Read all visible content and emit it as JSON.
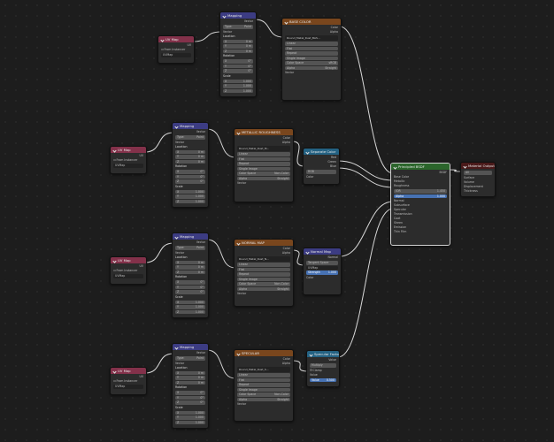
{
  "uv_node": {
    "title": "UV Map",
    "output": "UV",
    "from_instancer_label": "From Instancer",
    "map_value": "UVMap"
  },
  "mapping_node": {
    "title": "Mapping",
    "output": "Vector",
    "type_label": "Type:",
    "type_value": "Point",
    "vector_label": "Vector",
    "location_label": "Location",
    "rotation_label": "Rotation",
    "scale_label": "Scale",
    "x_label": "X",
    "y_label": "Y",
    "z_label": "Z",
    "loc_values": [
      "0 m",
      "0 m",
      "0 m"
    ],
    "rot_values": [
      "0°",
      "0°",
      "0°"
    ],
    "scale_values": [
      "1.000",
      "1.000",
      "1.000"
    ]
  },
  "tex_base": {
    "title": "BASE COLOR",
    "outputs": [
      "Color",
      "Alpha"
    ],
    "image": "Round_Metal_Rust_BAS...",
    "interp": "Linear",
    "proj": "Flat",
    "ext": "Repeat",
    "source": "Single Image",
    "colorspace_label": "Color Space",
    "colorspace": "sRGB",
    "alpha_label": "Alpha",
    "alpha": "Straight",
    "vector_label": "Vector"
  },
  "tex_metal": {
    "title": "METALLIC ROUGHNESS",
    "outputs": [
      "Color",
      "Alpha"
    ],
    "image": "Round_Metal_Rust_M...",
    "interp": "Linear",
    "proj": "Flat",
    "ext": "Repeat",
    "source": "Single Image",
    "colorspace_label": "Color Space",
    "colorspace": "Non-Color",
    "alpha_label": "Alpha",
    "alpha": "Straight",
    "vector_label": "Vector"
  },
  "tex_normal": {
    "title": "NORMAL MAP",
    "outputs": [
      "Color",
      "Alpha"
    ],
    "image": "Round_Metal_Rust_N...",
    "interp": "Linear",
    "proj": "Flat",
    "ext": "Repeat",
    "source": "Single Image",
    "colorspace_label": "Color Space",
    "colorspace": "Non-Color",
    "alpha_label": "Alpha",
    "alpha": "Straight",
    "vector_label": "Vector"
  },
  "tex_spec": {
    "title": "SPECULAR",
    "outputs": [
      "Color",
      "Alpha"
    ],
    "image": "Round_Metal_Rust_S...",
    "interp": "Linear",
    "proj": "Flat",
    "ext": "Repeat",
    "source": "Single Image",
    "colorspace_label": "Color Space",
    "colorspace": "Non-Color",
    "alpha_label": "Alpha",
    "alpha": "Straight",
    "vector_label": "Vector"
  },
  "separate_node": {
    "title": "Separate Color",
    "outputs": [
      "Red",
      "Green",
      "Blue"
    ],
    "mode": "RGB",
    "input": "Color"
  },
  "normalmap_node": {
    "title": "Normal Map",
    "output": "Normal",
    "space": "Tangent Space",
    "uvmap": "UVMap",
    "strength_label": "Strength",
    "strength": "1.000",
    "color_label": "Color"
  },
  "spec_node": {
    "title": "Specular Factor",
    "output": "Value",
    "multiply": "Multiply",
    "clamp": "Clamp",
    "value_label": "Value",
    "value": "0.500"
  },
  "bsdf_node": {
    "title": "Principled BSDF",
    "output": "BSDF",
    "inputs": [
      "Base Color",
      "Metallic",
      "Roughness",
      "IOR",
      "Alpha",
      "Normal",
      "Subsurface",
      "Specular",
      "Transmission",
      "Coat",
      "Sheen",
      "Emission",
      "Thin Film"
    ],
    "ior": "1.450",
    "alpha": "1.000"
  },
  "output_node": {
    "title": "Material Output",
    "target": "All",
    "inputs": [
      "Surface",
      "Volume",
      "Displacement",
      "Thickness"
    ]
  },
  "colors": {
    "canvas": "#1d1d1d",
    "wire": "#d8d8d8",
    "texture_header": "#79461d",
    "vector_header": "#3c3c83",
    "input_header": "#83314a",
    "shader_header": "#2b652b",
    "output_header": "#4a1a1a",
    "separate_header": "#246283"
  }
}
